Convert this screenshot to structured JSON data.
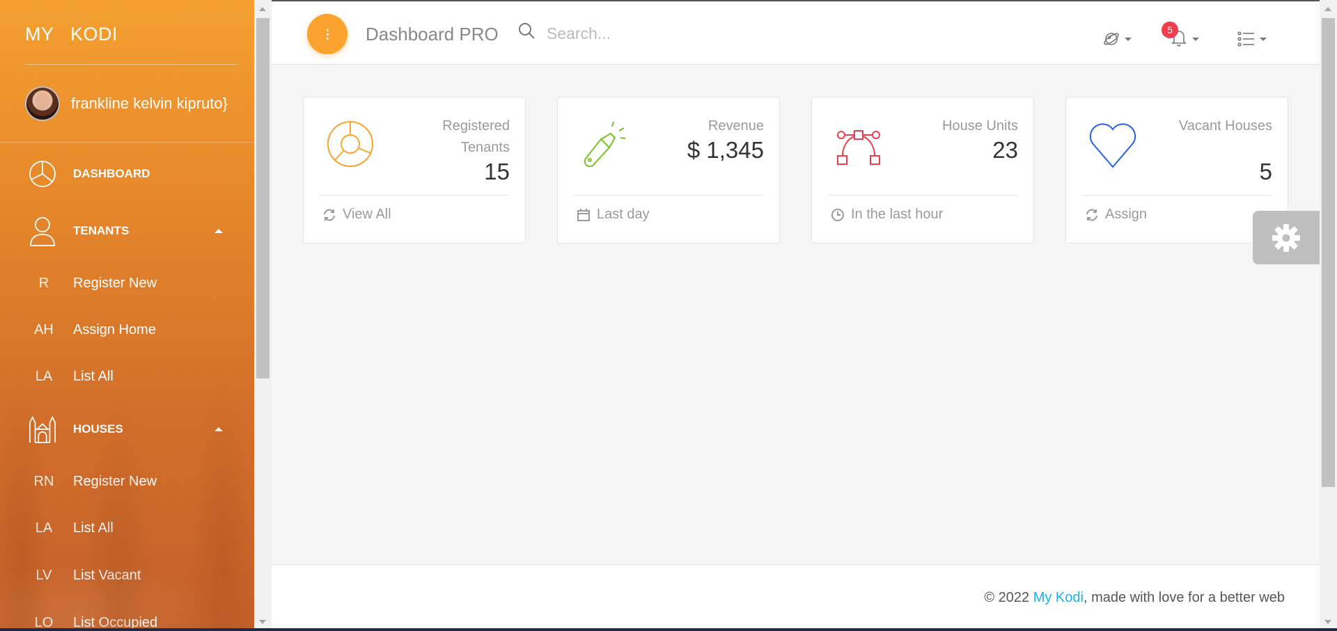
{
  "sidebar": {
    "brand": "MY   KODI",
    "user_name": "frankline kelvin kipruto}",
    "dashboard_label": "DASHBOARD",
    "tenants_label": "TENANTS",
    "tenants_items": [
      {
        "abbr": "R",
        "label": "Register New"
      },
      {
        "abbr": "AH",
        "label": "Assign Home"
      },
      {
        "abbr": "LA",
        "label": "List All"
      }
    ],
    "houses_label": "HOUSES",
    "houses_items": [
      {
        "abbr": "RN",
        "label": "Register New"
      },
      {
        "abbr": "LA",
        "label": "List All"
      },
      {
        "abbr": "LV",
        "label": "List Vacant"
      },
      {
        "abbr": "LO",
        "label": "List Occupied"
      }
    ]
  },
  "topbar": {
    "title": "Dashboard PRO",
    "search_placeholder": "Search...",
    "notification_count": "5"
  },
  "cards": [
    {
      "category": "Registered Tenants",
      "value": "15",
      "footer": "View All",
      "icon": "chart-pie-icon",
      "color": "#fba32e",
      "footer_icon": "refresh-icon"
    },
    {
      "category": "Revenue",
      "value": "$ 1,345",
      "footer": "Last day",
      "icon": "flashlight-icon",
      "color": "#7ac029",
      "footer_icon": "calendar-icon"
    },
    {
      "category": "House Units",
      "value": "23",
      "footer": "In the last hour",
      "icon": "vector-icon",
      "color": "#f03d4d",
      "footer_icon": "clock-icon"
    },
    {
      "category": "Vacant Houses",
      "value": "5",
      "footer": "Assign",
      "icon": "heart-icon",
      "color": "#2260e6",
      "footer_icon": "refresh-icon"
    }
  ],
  "footer": {
    "prefix": "© 2022 ",
    "link": "My Kodi",
    "suffix": ", made with love for a better web"
  },
  "colors": {
    "accent": "#fba32e",
    "link": "#1db0e6",
    "badge": "#f03d4d"
  }
}
